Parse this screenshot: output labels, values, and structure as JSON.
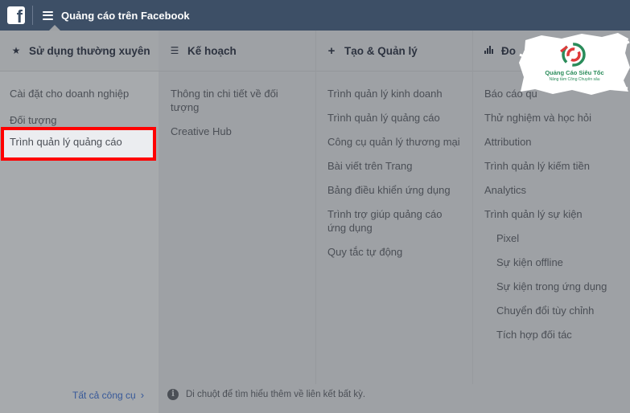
{
  "header": {
    "app_title": "Quảng cáo trên Facebook"
  },
  "columns": [
    {
      "title": "Sử dụng thường xuyên",
      "icon": "star-icon",
      "items": [
        "Cài đặt cho doanh nghiệp",
        "Đối tượng"
      ],
      "highlighted_item": "Trình quản lý quảng cáo"
    },
    {
      "title": "Kế hoạch",
      "icon": "list-icon",
      "items": [
        "Thông tin chi tiết về đối tượng",
        "Creative Hub"
      ]
    },
    {
      "title": "Tạo & Quản lý",
      "icon": "plus-icon",
      "items": [
        "Trình quản lý kinh doanh",
        "Trình quản lý quảng cáo",
        "Công cụ quản lý thương mại",
        "Bài viết trên Trang",
        "Bảng điều khiển ứng dụng",
        "Trình trợ giúp quảng cáo ứng dụng",
        "Quy tắc tự động"
      ]
    },
    {
      "title": "Đo",
      "icon": "bar-chart-icon",
      "items": [
        "Báo cáo qu",
        "Thử nghiệm và học hỏi",
        "Attribution",
        "Trình quản lý kiếm tiền",
        "Analytics",
        "Trình quản lý sự kiện"
      ],
      "sub_items": [
        "Pixel",
        "Sự kiện offline",
        "Sự kiện trong ứng dụng",
        "Chuyển đổi tùy chỉnh",
        "Tích hợp đối tác"
      ]
    }
  ],
  "footer": {
    "all_tools": "Tất cả công cụ",
    "tip": "Di chuột để tìm hiểu thêm về liên kết bất kỳ."
  },
  "watermark": {
    "brand": "Quảng Cáo Siêu Tốc",
    "tagline": "Nâng tầm Công Chuyên sâu"
  },
  "colors": {
    "topbar": "#3d4f66",
    "highlight_border": "#ff0000",
    "link": "#365899"
  }
}
